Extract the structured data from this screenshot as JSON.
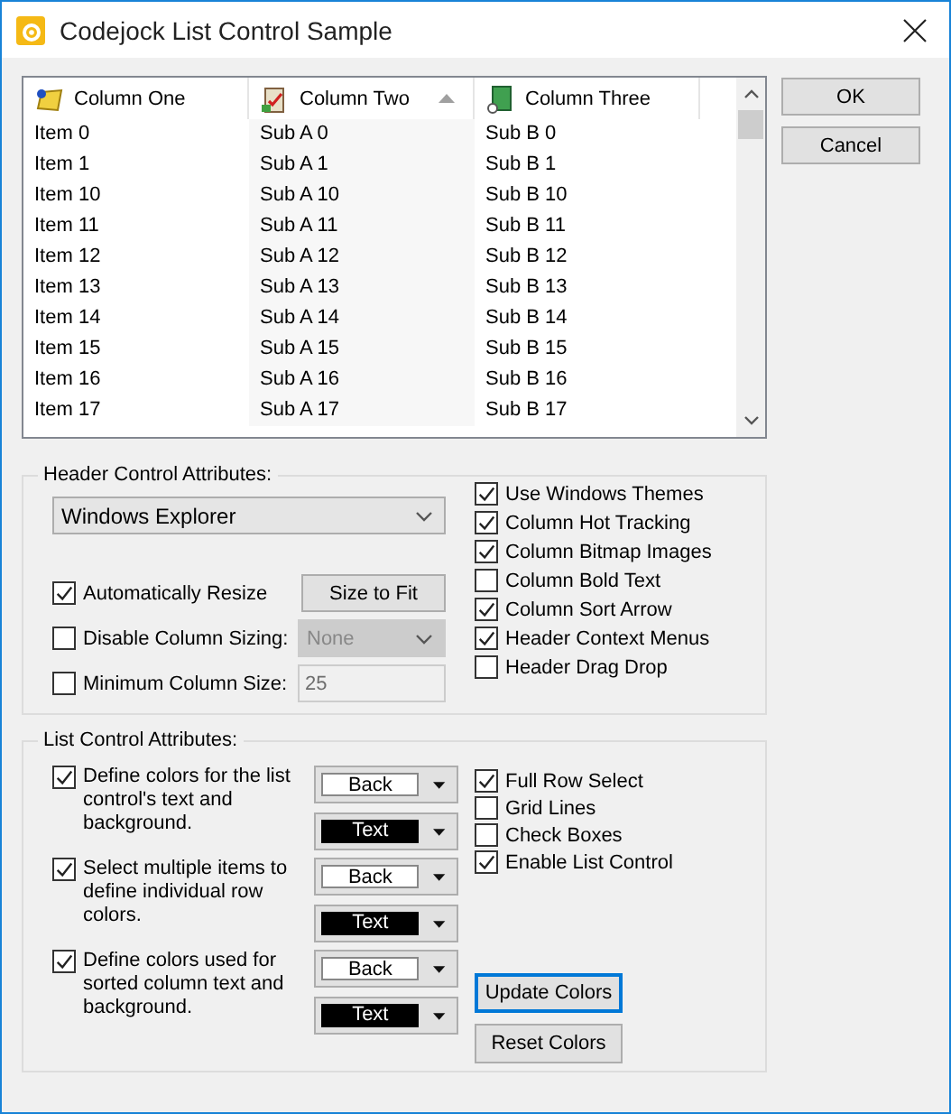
{
  "window": {
    "title": "Codejock List Control Sample"
  },
  "list": {
    "columns": [
      {
        "label": "Column One",
        "sorted": false
      },
      {
        "label": "Column Two",
        "sorted": true
      },
      {
        "label": "Column Three",
        "sorted": false
      }
    ],
    "rows": [
      [
        "Item 0",
        "Sub A 0",
        "Sub B 0"
      ],
      [
        "Item 1",
        "Sub A 1",
        "Sub B 1"
      ],
      [
        "Item 10",
        "Sub A 10",
        "Sub B 10"
      ],
      [
        "Item 11",
        "Sub A 11",
        "Sub B 11"
      ],
      [
        "Item 12",
        "Sub A 12",
        "Sub B 12"
      ],
      [
        "Item 13",
        "Sub A 13",
        "Sub B 13"
      ],
      [
        "Item 14",
        "Sub A 14",
        "Sub B 14"
      ],
      [
        "Item 15",
        "Sub A 15",
        "Sub B 15"
      ],
      [
        "Item 16",
        "Sub A 16",
        "Sub B 16"
      ],
      [
        "Item 17",
        "Sub A 17",
        "Sub B 17"
      ]
    ]
  },
  "buttons": [
    {
      "label": "OK"
    },
    {
      "label": "Cancel"
    }
  ],
  "header_group": {
    "title": "Header Control Attributes:",
    "style_select": {
      "value": "Windows Explorer"
    },
    "auto_resize": {
      "label": "Automatically Resize",
      "checked": true
    },
    "size_to_fit": {
      "label": "Size to Fit"
    },
    "disable_sizing": {
      "label": "Disable Column Sizing:",
      "checked": false,
      "value": "None",
      "disabled": true
    },
    "min_size": {
      "label": "Minimum Column Size:",
      "checked": false,
      "value": "25",
      "disabled": true
    },
    "options": [
      {
        "label": "Use Windows Themes",
        "checked": true
      },
      {
        "label": "Column Hot Tracking",
        "checked": true
      },
      {
        "label": "Column Bitmap Images",
        "checked": true
      },
      {
        "label": "Column Bold Text",
        "checked": false
      },
      {
        "label": "Column Sort Arrow",
        "checked": true
      },
      {
        "label": "Header Context Menus",
        "checked": true
      },
      {
        "label": "Header Drag Drop",
        "checked": false
      }
    ]
  },
  "list_group": {
    "title": "List Control Attributes:",
    "color_rows": [
      {
        "label": "Define colors for the list control's text and background.",
        "checked": true,
        "back": "Back",
        "text": "Text"
      },
      {
        "label": "Select multiple items to define individual row colors.",
        "checked": true,
        "back": "Back",
        "text": "Text"
      },
      {
        "label": "Define colors used for sorted column text and background.",
        "checked": true,
        "back": "Back",
        "text": "Text"
      }
    ],
    "options": [
      {
        "label": "Full Row Select",
        "checked": true
      },
      {
        "label": "Grid Lines",
        "checked": false
      },
      {
        "label": "Check Boxes",
        "checked": false
      },
      {
        "label": "Enable List Control",
        "checked": true
      }
    ],
    "buttons": [
      {
        "label": "Update Colors",
        "focused": true
      },
      {
        "label": "Reset Colors",
        "focused": false
      }
    ]
  }
}
